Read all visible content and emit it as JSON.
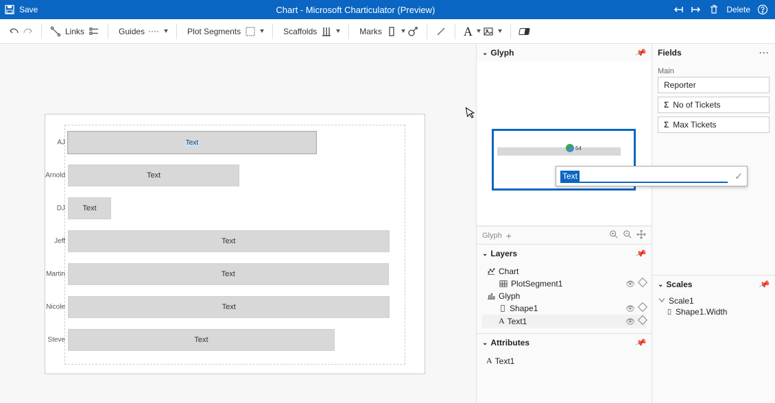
{
  "titlebar": {
    "save_label": "Save",
    "title": "Chart - Microsoft Charticulator (Preview)",
    "delete_label": "Delete"
  },
  "toolbar": {
    "links_label": "Links",
    "guides_label": "Guides",
    "plot_segments_label": "Plot Segments",
    "scaffolds_label": "Scaffolds",
    "marks_label": "Marks"
  },
  "chart_data": {
    "type": "bar",
    "orientation": "horizontal",
    "categories": [
      "AJ",
      "Arnold",
      "DJ",
      "Jeff",
      "Martin",
      "Nicole",
      "Steve"
    ],
    "values": [
      373,
      258,
      65,
      483,
      482,
      484,
      401
    ],
    "mark_label": "Text",
    "xlabel": "",
    "ylabel": "",
    "xlim": [
      0,
      500
    ]
  },
  "glyph_panel": {
    "title": "Glyph",
    "foot_label": "Glyph",
    "edit_value": "Text",
    "mark_mini_label": "54"
  },
  "layers_panel": {
    "title": "Layers",
    "chart_label": "Chart",
    "plotsegment_label": "PlotSegment1",
    "glyph_label": "Glyph",
    "shape_label": "Shape1",
    "text_label": "Text1"
  },
  "attributes_panel": {
    "title": "Attributes",
    "current_label": "Text1"
  },
  "fields_panel": {
    "title": "Fields",
    "section_label": "Main",
    "items": [
      "Reporter",
      "No of Tickets",
      "Max Tickets"
    ]
  },
  "scales_panel": {
    "title": "Scales",
    "scale_label": "Scale1",
    "binding_label": "Shape1.Width"
  }
}
